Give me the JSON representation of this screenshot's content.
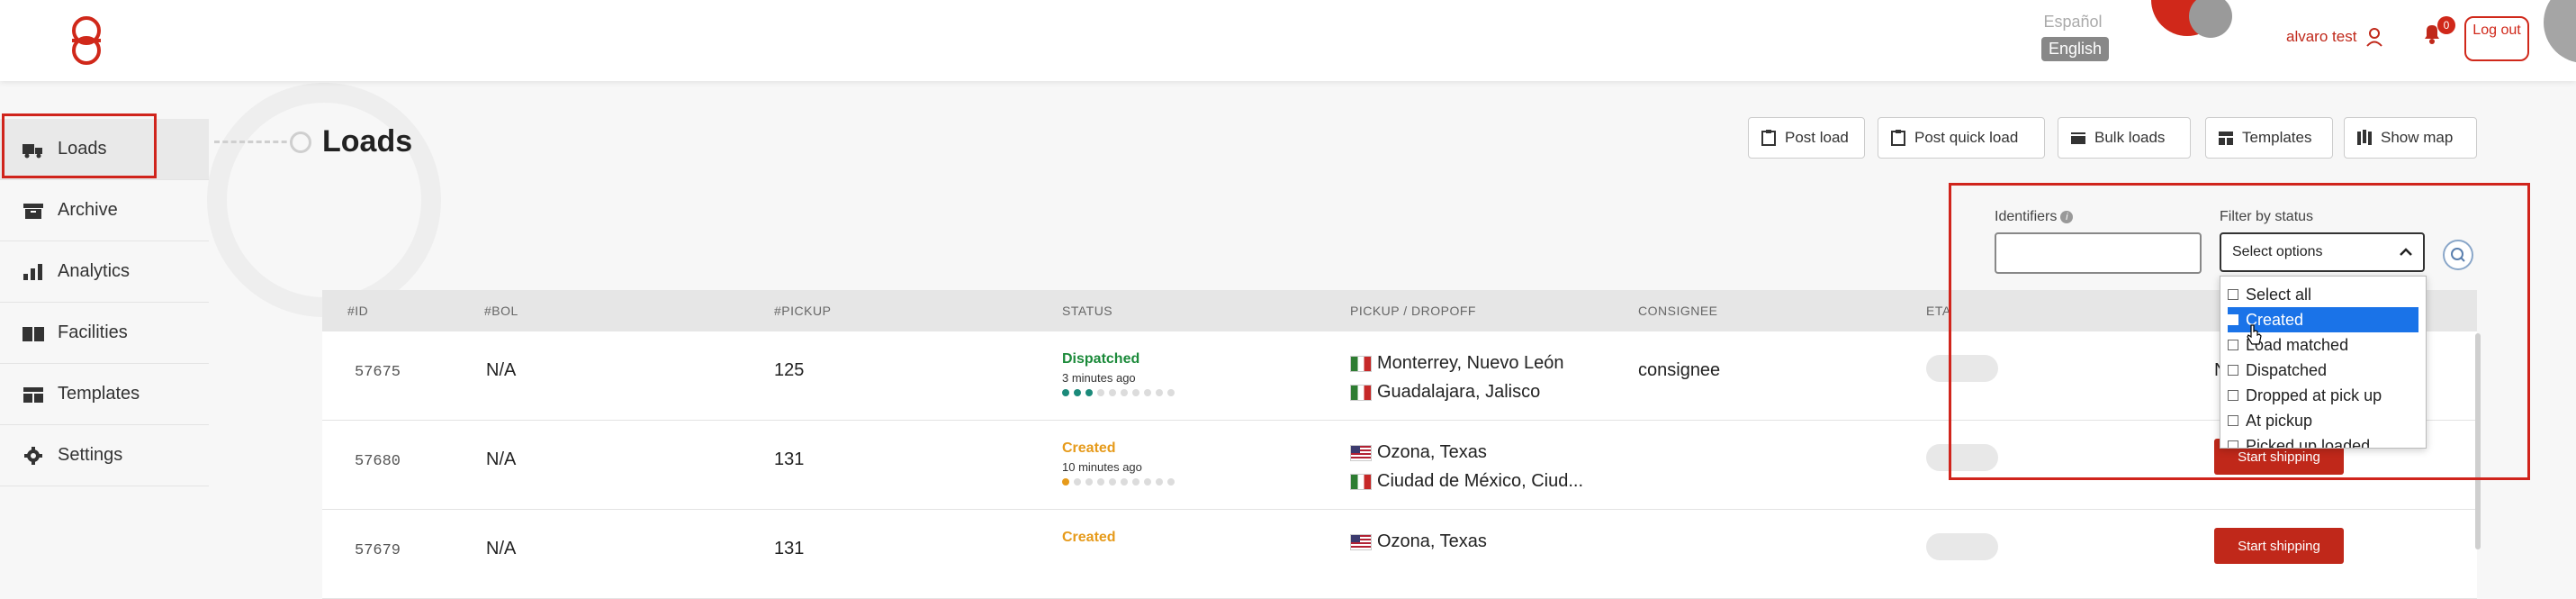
{
  "header": {
    "lang_es": "Español",
    "lang_en": "English",
    "user_name": "alvaro test",
    "notifications_count": "0",
    "logout_label": "Log out",
    "brand_color": "#d0281a"
  },
  "sidebar": {
    "items": [
      {
        "label": "Loads",
        "icon": "truck-icon"
      },
      {
        "label": "Archive",
        "icon": "archive-icon"
      },
      {
        "label": "Analytics",
        "icon": "bar-chart-icon"
      },
      {
        "label": "Facilities",
        "icon": "warehouse-icon"
      },
      {
        "label": "Templates",
        "icon": "template-icon"
      },
      {
        "label": "Settings",
        "icon": "gear-icon"
      }
    ]
  },
  "page": {
    "title": "Loads",
    "toolbar": {
      "post_load": "Post load",
      "post_quick_load": "Post quick load",
      "bulk_loads": "Bulk loads",
      "templates": "Templates",
      "show_map": "Show map"
    }
  },
  "filters": {
    "identifiers_label": "Identifiers",
    "identifiers_value": "",
    "status_label": "Filter by status",
    "status_placeholder": "Select options",
    "options": [
      "Select all",
      "Created",
      "Load matched",
      "Dispatched",
      "Dropped at pick up",
      "At pickup",
      "Picked up loaded"
    ],
    "highlighted_option": "Created"
  },
  "table": {
    "headers": [
      "#ID",
      "#BOL",
      "#PICKUP",
      "STATUS",
      "PICKUP / DROPOFF",
      "CONSIGNEE",
      "ETA"
    ],
    "rows": [
      {
        "id": "57675",
        "bol": "N/A",
        "pickup": "125",
        "status": "Dispatched",
        "status_color": "#1b8a3a",
        "status_time": "3 minutes ago",
        "progress_filled": 3,
        "origin": "Monterrey, Nuevo León",
        "origin_country": "MX",
        "destination": "Guadalajara, Jalisco",
        "destination_country": "MX",
        "consignee": "consignee",
        "trailing": "N"
      },
      {
        "id": "57680",
        "bol": "N/A",
        "pickup": "131",
        "status": "Created",
        "status_color": "#e69a1a",
        "status_time": "10 minutes ago",
        "progress_filled": 1,
        "origin": "Ozona, Texas",
        "origin_country": "US",
        "destination": "Ciudad de México, Ciud...",
        "destination_country": "MX",
        "consignee": "",
        "action": "Start shipping"
      },
      {
        "id": "57679",
        "bol": "N/A",
        "pickup": "131",
        "status": "Created",
        "status_color": "#e69a1a",
        "origin": "Ozona, Texas",
        "origin_country": "US",
        "action": "Start shipping"
      }
    ]
  }
}
